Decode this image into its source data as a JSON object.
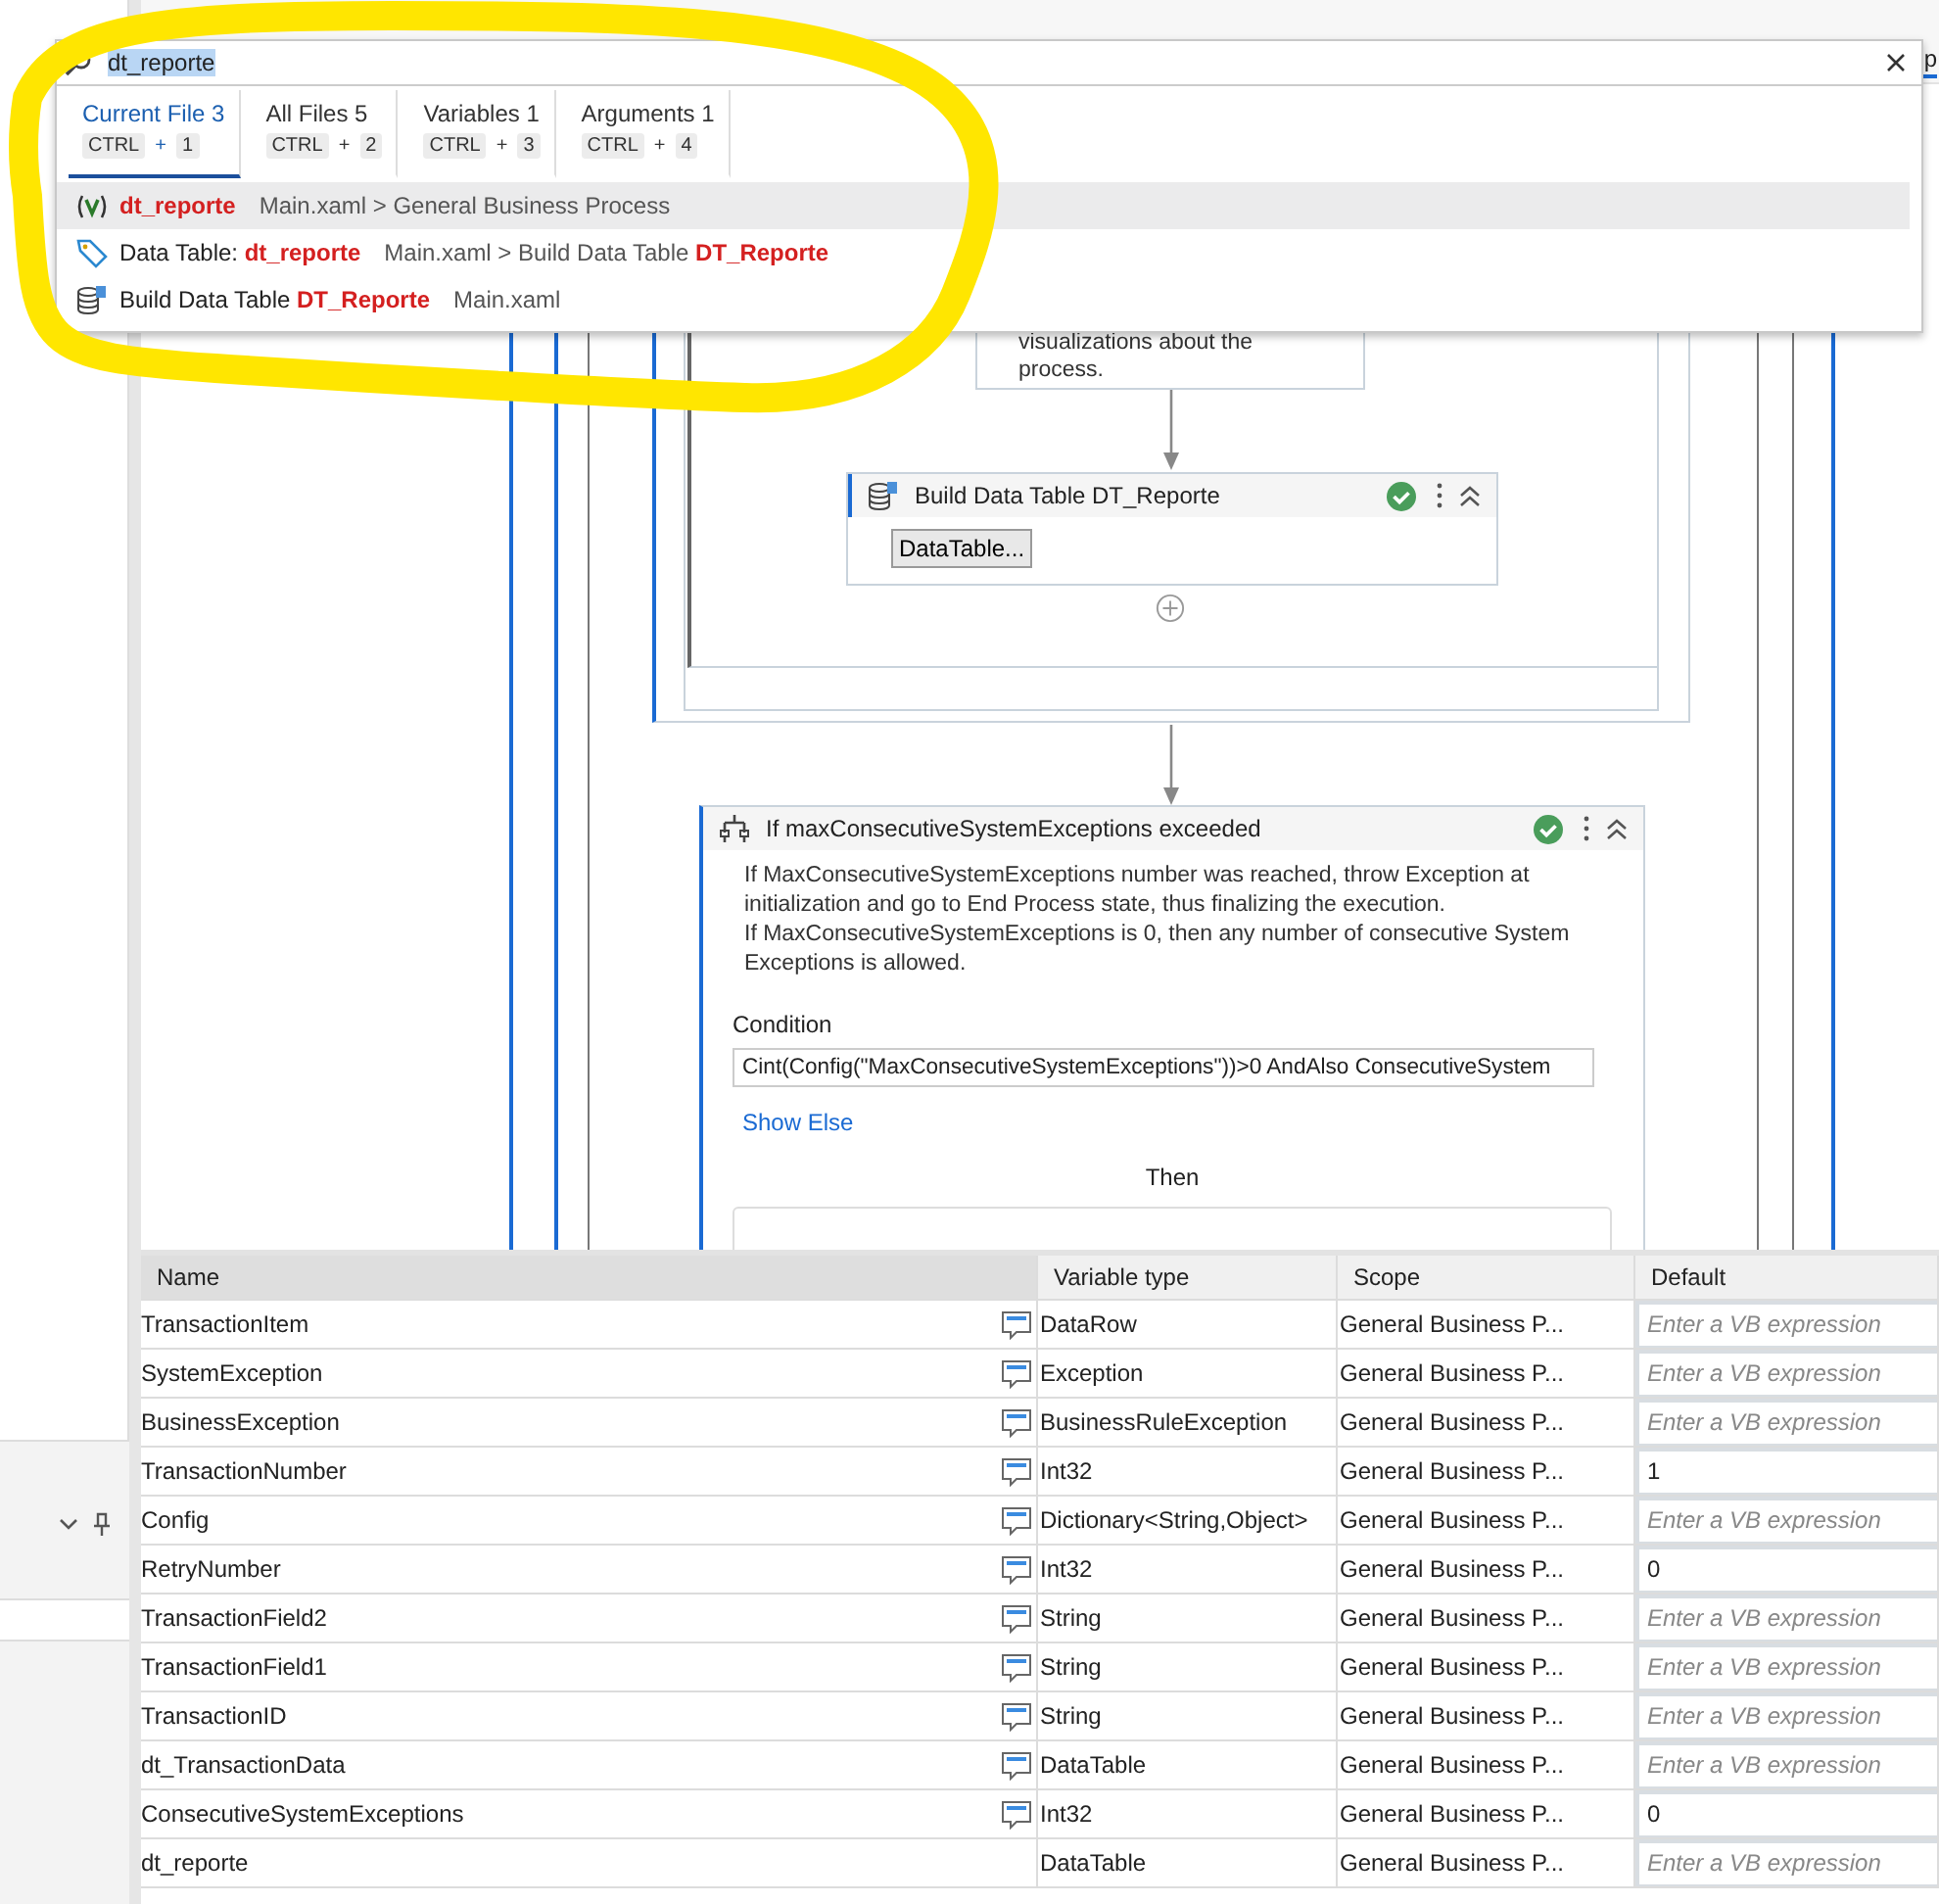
{
  "search_popup": {
    "query": "dt_reporte",
    "tabs": [
      {
        "label": "Current File",
        "count": "3",
        "keys": [
          "CTRL",
          "1"
        ],
        "joiner": "+",
        "selected": true
      },
      {
        "label": "All Files",
        "count": "5",
        "keys": [
          "CTRL",
          "2"
        ],
        "joiner": "+",
        "selected": false
      },
      {
        "label": "Variables",
        "count": "1",
        "keys": [
          "CTRL",
          "3"
        ],
        "joiner": "+",
        "selected": false
      },
      {
        "label": "Arguments",
        "count": "1",
        "keys": [
          "CTRL",
          "4"
        ],
        "joiner": "+",
        "selected": false
      }
    ],
    "results": [
      {
        "kind": "variable",
        "title": "**dt_reporte**",
        "location": "Main.xaml > General Business Process",
        "selected": true
      },
      {
        "kind": "tag",
        "title": "Data Table: **dt_reporte**",
        "location": "Main.xaml > Build Data Table **DT_Reporte**",
        "selected": false
      },
      {
        "kind": "table",
        "title": "Build Data Table **DT_Reporte**",
        "location": "Main.xaml",
        "selected": false
      }
    ]
  },
  "top_tab_fragment": "p",
  "canvas": {
    "annotation": "visualizations about the process.",
    "build_activity": {
      "title": "Build Data Table DT_Reporte",
      "button": "DataTable...",
      "valid": true
    },
    "if_activity": {
      "title": "If maxConsecutiveSystemExceptions exceeded",
      "valid": true,
      "description": [
        "If MaxConsecutiveSystemExceptions number was reached, throw Exception at initialization and go to End Process state, thus finalizing the execution.",
        "If MaxConsecutiveSystemExceptions is 0, then any number of consecutive System Exceptions is allowed."
      ],
      "condition_label": "Condition",
      "condition": "Cint(Config(\"MaxConsecutiveSystemExceptions\"))>0 AndAlso ConsecutiveSystem",
      "show_else": "Show Else",
      "then_label": "Then"
    }
  },
  "variables": {
    "columns": [
      "Name",
      "Variable type",
      "Scope",
      "Default"
    ],
    "rows": [
      {
        "name": "TransactionItem",
        "annotation": true,
        "type": "DataRow",
        "scope": "General Business P...",
        "placeholder": "Enter a VB expression"
      },
      {
        "name": "SystemException",
        "annotation": true,
        "type": "Exception",
        "scope": "General Business P...",
        "placeholder": "Enter a VB expression"
      },
      {
        "name": "BusinessException",
        "annotation": true,
        "type": "BusinessRuleException",
        "scope": "General Business P...",
        "placeholder": "Enter a VB expression"
      },
      {
        "name": "TransactionNumber",
        "annotation": true,
        "type": "Int32",
        "scope": "General Business P...",
        "default": "1"
      },
      {
        "name": "Config",
        "annotation": true,
        "type": "Dictionary<String,Object>",
        "scope": "General Business P...",
        "placeholder": "Enter a VB expression"
      },
      {
        "name": "RetryNumber",
        "annotation": true,
        "type": "Int32",
        "scope": "General Business P...",
        "default": "0"
      },
      {
        "name": "TransactionField2",
        "annotation": true,
        "type": "String",
        "scope": "General Business P...",
        "placeholder": "Enter a VB expression"
      },
      {
        "name": "TransactionField1",
        "annotation": true,
        "type": "String",
        "scope": "General Business P...",
        "placeholder": "Enter a VB expression"
      },
      {
        "name": "TransactionID",
        "annotation": true,
        "type": "String",
        "scope": "General Business P...",
        "placeholder": "Enter a VB expression"
      },
      {
        "name": "dt_TransactionData",
        "annotation": true,
        "type": "DataTable",
        "scope": "General Business P...",
        "placeholder": "Enter a VB expression"
      },
      {
        "name": "ConsecutiveSystemExceptions",
        "annotation": true,
        "type": "Int32",
        "scope": "General Business P...",
        "default": "0"
      },
      {
        "name": "dt_reporte",
        "annotation": false,
        "type": "DataTable",
        "scope": "General Business P...",
        "placeholder": "Enter a VB expression"
      }
    ]
  }
}
